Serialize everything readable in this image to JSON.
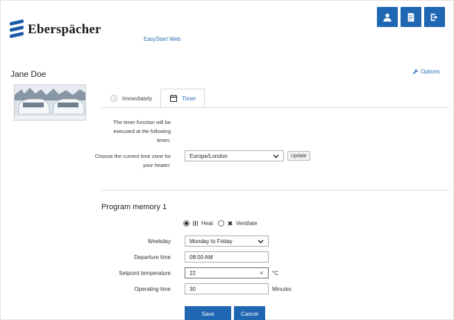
{
  "header": {
    "brand": "Eberspächer",
    "app_name": "EasyStart Web",
    "buttons": [
      {
        "icon": "user-icon"
      },
      {
        "icon": "document-icon"
      },
      {
        "icon": "logout-icon"
      }
    ]
  },
  "user": {
    "name": "Jane Doe",
    "options_label": "Options"
  },
  "tabs": [
    {
      "label": "Immediately",
      "icon": "timer-icon",
      "active": false
    },
    {
      "label": "Timer",
      "icon": "calendar-icon",
      "active": true
    }
  ],
  "timer": {
    "description": "The timer function will be executed at the following times:",
    "timezone_label": "Choose the current time zone for your heater:",
    "timezone_value": "Europe/London",
    "update_label": "Update"
  },
  "program": {
    "title": "Program memory 1",
    "mode_heat": "Heat",
    "mode_ventilate": "Ventilate",
    "selected_mode": "Heat",
    "weekday_label": "Weekday",
    "weekday_value": "Monday to Friday",
    "departure_label": "Departure time",
    "departure_value": "08:00 AM",
    "setpoint_label": "Setpoint temperature",
    "setpoint_value": "22",
    "setpoint_unit": "°C",
    "operating_label": "Operating time",
    "operating_value": "30",
    "operating_unit": "Minutes"
  },
  "actions": {
    "save": "Save",
    "cancel": "Cancel"
  },
  "colors": {
    "accent": "#1f66b3",
    "link": "#2a6cb5"
  }
}
